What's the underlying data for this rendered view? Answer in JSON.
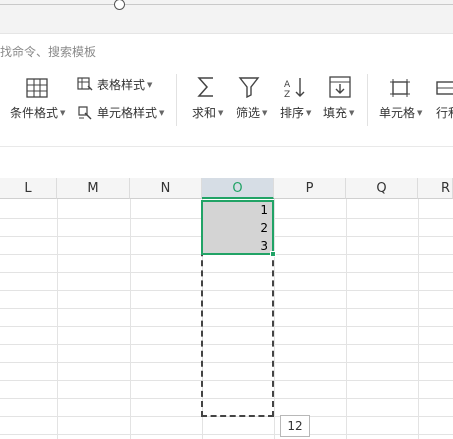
{
  "search": {
    "text": "找命令、搜索模板"
  },
  "ribbon": {
    "conditional_format": "条件格式",
    "table_style": "表格样式",
    "cell_style": "单元格样式",
    "sum": "求和",
    "filter": "筛选",
    "sort": "排序",
    "fill": "填充",
    "cell": "单元格",
    "row_col": "行和"
  },
  "sheet": {
    "columns": [
      "L",
      "M",
      "N",
      "O",
      "P",
      "Q",
      "R"
    ],
    "active_column": "O",
    "cells": [
      "1",
      "2",
      "3"
    ],
    "fill_tooltip": "12"
  },
  "colors": {
    "accent": "#21a366",
    "selection_fill": "#d4d4d4"
  }
}
